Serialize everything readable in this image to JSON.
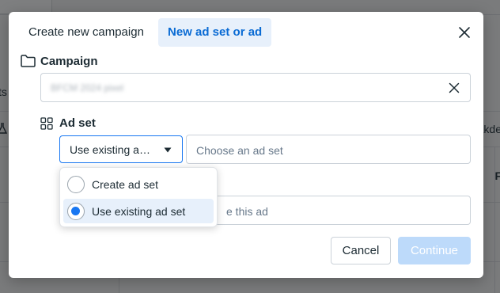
{
  "background": {
    "fragments": [
      "ts",
      "akde",
      "F"
    ]
  },
  "modal": {
    "tabs": {
      "create_new_campaign": "Create new campaign",
      "new_ad_set_or_ad": "New ad set or ad"
    },
    "close_icon": "close-icon",
    "campaign": {
      "title": "Campaign",
      "icon": "folder-icon",
      "value": "BFCM 2024 pixel",
      "clear_icon": "clear-icon"
    },
    "ad_set": {
      "title": "Ad set",
      "icon": "grid-icon",
      "select_value": "Use existing ad set",
      "ad_set_placeholder": "Choose an ad set",
      "ad_name_placeholder_visible": "e this ad",
      "dropdown_options": [
        {
          "label": "Create ad set",
          "selected": false
        },
        {
          "label": "Use existing ad set",
          "selected": true
        }
      ]
    },
    "buttons": {
      "cancel": "Cancel",
      "continue": "Continue"
    }
  },
  "colors": {
    "accent": "#1877f2",
    "tab_active_bg": "#e7f0fb",
    "tab_active_text": "#0a6bd4",
    "continue_disabled_bg": "#bddafa"
  }
}
